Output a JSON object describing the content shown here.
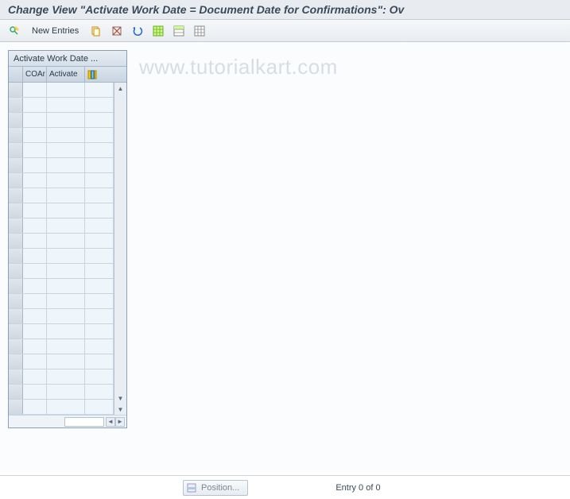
{
  "title": "Change View \"Activate Work Date = Document Date for Confirmations\": Ov",
  "toolbar": {
    "new_entries": "New Entries"
  },
  "grid": {
    "panel_title": "Activate Work Date ...",
    "columns": {
      "coar": "COAr",
      "activate": "Activate"
    },
    "row_count": 22
  },
  "footer": {
    "position_label": "Position...",
    "entry_text": "Entry 0 of 0"
  },
  "watermark": "www.tutorialkart.com"
}
